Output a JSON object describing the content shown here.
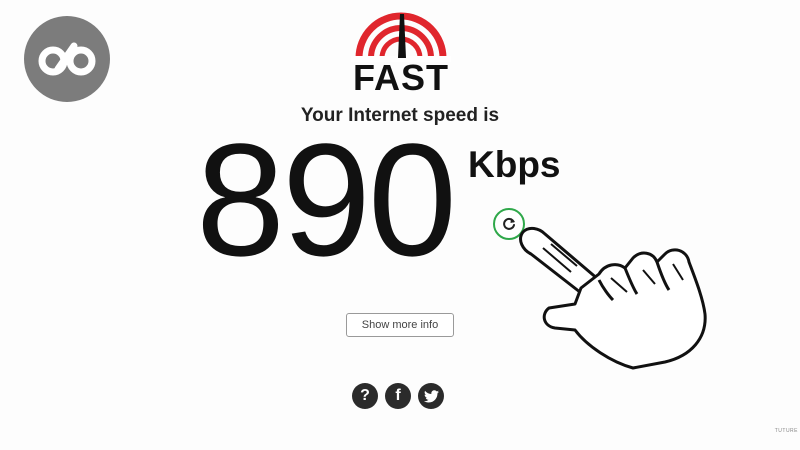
{
  "watermark": {
    "icon": "infinity-logo-icon",
    "background_color": "#7c7c7c"
  },
  "logo": {
    "word": "FAST",
    "accent_color": "#e0262d",
    "icon": "speed-gauge-icon"
  },
  "result": {
    "headline": "Your Internet speed is",
    "value": "890",
    "unit": "Kbps"
  },
  "actions": {
    "refresh_icon": "refresh-icon",
    "refresh_color": "#2fa84a",
    "show_more_label": "Show more info"
  },
  "social": [
    {
      "name": "help",
      "icon": "question-icon",
      "glyph": "?"
    },
    {
      "name": "facebook",
      "icon": "facebook-icon",
      "glyph": "f"
    },
    {
      "name": "twitter",
      "icon": "twitter-icon",
      "glyph": ""
    }
  ],
  "overlay": {
    "cursor_icon": "hand-pointer-icon"
  },
  "footer": {
    "credit": "TUTURE"
  }
}
